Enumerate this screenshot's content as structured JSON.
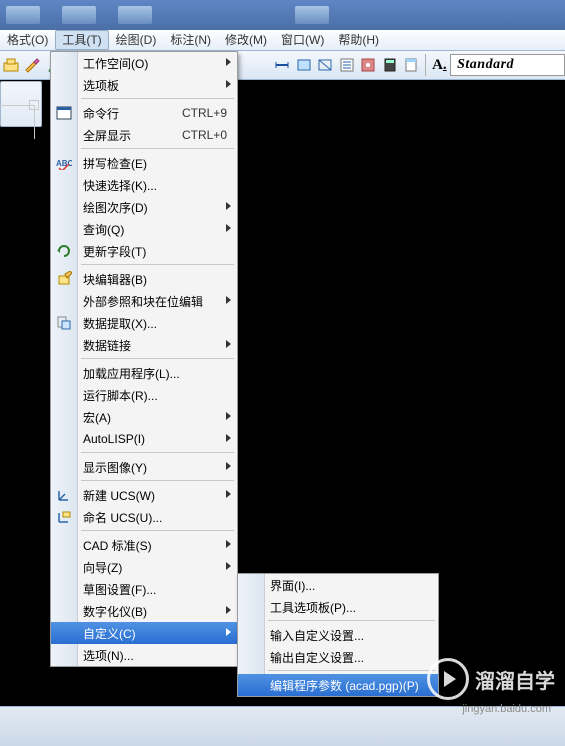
{
  "menubar": {
    "format": "格式(O)",
    "tools": "工具(T)",
    "draw": "绘图(D)",
    "dimension": "标注(N)",
    "modify": "修改(M)",
    "window": "窗口(W)",
    "help": "帮助(H)"
  },
  "style_box": "Standard",
  "main_menu": {
    "workspace": "工作空间(O)",
    "palettes": "选项板",
    "commandline": "命令行",
    "commandline_sc": "CTRL+9",
    "fullscreen": "全屏显示",
    "fullscreen_sc": "CTRL+0",
    "spellcheck": "拼写检查(E)",
    "quickselect": "快速选择(K)...",
    "draworder": "绘图次序(D)",
    "inquiry": "查询(Q)",
    "updatefields": "更新字段(T)",
    "blockeditor": "块编辑器(B)",
    "xref_inplace": "外部参照和块在位编辑",
    "dataextract": "数据提取(X)...",
    "datalinks": "数据链接",
    "loadapp": "加载应用程序(L)...",
    "runscript": "运行脚本(R)...",
    "macro": "宏(A)",
    "autolisp": "AutoLISP(I)",
    "displayimage": "显示图像(Y)",
    "newucs": "新建 UCS(W)",
    "namedocs": "命名 UCS(U)...",
    "cadstd": "CAD 标准(S)",
    "wizards": "向导(Z)",
    "draftsettings": "草图设置(F)...",
    "tablet": "数字化仪(B)",
    "customize": "自定义(C)",
    "options": "选项(N)..."
  },
  "sub_menu": {
    "interface": "界面(I)...",
    "toolpalettes": "工具选项板(P)...",
    "importcustom": "输入自定义设置...",
    "exportcustom": "输出自定义设置...",
    "editpgp": "编辑程序参数 (acad.pgp)(P)"
  },
  "watermark": {
    "brand": "溜溜自学",
    "sub": "jingyan.baidu.com"
  }
}
